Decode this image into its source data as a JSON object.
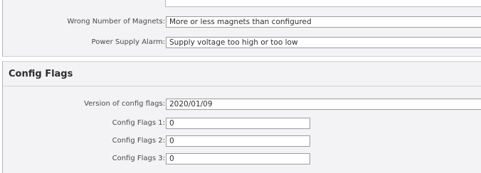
{
  "alarms": {
    "wrong_magnets": {
      "label": "Wrong Number of Magnets:",
      "value": "More or less magnets than configured"
    },
    "power_supply": {
      "label": "Power Supply Alarm:",
      "value": "Supply voltage too high or too low"
    }
  },
  "config_flags": {
    "title": "Config Flags",
    "version": {
      "label": "Version of config flags:",
      "value": "2020/01/09"
    },
    "flags": [
      {
        "label": "Config Flags 1:",
        "value": "0"
      },
      {
        "label": "Config Flags 2:",
        "value": "0"
      },
      {
        "label": "Config Flags 3:",
        "value": "0"
      }
    ]
  }
}
